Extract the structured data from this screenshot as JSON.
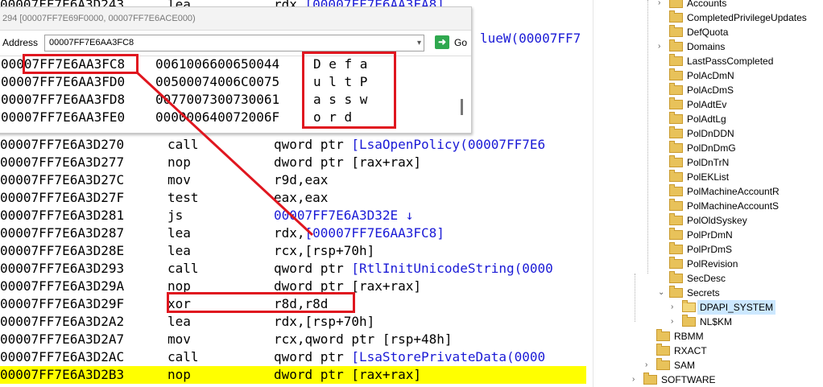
{
  "disasm": {
    "top_partial": {
      "addr": "00007FF7E6A3D243",
      "mnemonic": "lea",
      "operand_plain": "rdx,",
      "operand_link": "[00007FF7E6AA3FA8]"
    },
    "side_fragment": "lueW(00007FF7",
    "rows": [
      {
        "addr": "00007FF7E6A3D270",
        "mnemonic": "call",
        "op": "qword ptr ",
        "link": "[LsaOpenPolicy(00007FF7E6",
        "after": ""
      },
      {
        "addr": "00007FF7E6A3D277",
        "mnemonic": "nop",
        "op": "dword ptr [rax+rax]",
        "link": "",
        "after": ""
      },
      {
        "addr": "00007FF7E6A3D27C",
        "mnemonic": "mov",
        "op": "r9d,eax",
        "link": "",
        "after": ""
      },
      {
        "addr": "00007FF7E6A3D27F",
        "mnemonic": "test",
        "op": "eax,eax",
        "link": "",
        "after": ""
      },
      {
        "addr": "00007FF7E6A3D281",
        "mnemonic": "js",
        "op": "",
        "link": "00007FF7E6A3D32E",
        "after": " ↓"
      },
      {
        "addr": "00007FF7E6A3D287",
        "mnemonic": "lea",
        "op": "rdx,",
        "link": "[00007FF7E6AA3FC8]",
        "after": ""
      },
      {
        "addr": "00007FF7E6A3D28E",
        "mnemonic": "lea",
        "op": "rcx,[rsp+70h]",
        "link": "",
        "after": ""
      },
      {
        "addr": "00007FF7E6A3D293",
        "mnemonic": "call",
        "op": "qword ptr ",
        "link": "[RtlInitUnicodeString(0000",
        "after": ""
      },
      {
        "addr": "00007FF7E6A3D29A",
        "mnemonic": "nop",
        "op": "dword ptr [rax+rax]",
        "link": "",
        "after": ""
      },
      {
        "addr": "00007FF7E6A3D29F",
        "mnemonic": "xor",
        "op": "r8d,r8d",
        "link": "",
        "after": ""
      },
      {
        "addr": "00007FF7E6A3D2A2",
        "mnemonic": "lea",
        "op": "rdx,[rsp+70h]",
        "link": "",
        "after": ""
      },
      {
        "addr": "00007FF7E6A3D2A7",
        "mnemonic": "mov",
        "op": "rcx,qword ptr [rsp+48h]",
        "link": "",
        "after": ""
      },
      {
        "addr": "00007FF7E6A3D2AC",
        "mnemonic": "call",
        "op": "qword ptr ",
        "link": "[LsaStorePrivateData(0000",
        "after": ""
      },
      {
        "addr": "00007FF7E6A3D2B3",
        "mnemonic": "nop",
        "op": "dword ptr [rax+rax]",
        "link": "",
        "after": ""
      }
    ],
    "current_row_index": 13,
    "highlight_color": "#ffff00",
    "link_color": "#1a1ad6"
  },
  "memory_window": {
    "title": "294 [00007FF7E69F0000, 00007FF7E6ACE000)",
    "address_label": "Address",
    "address_value": "00007FF7E6AA3FC8",
    "go_label": "Go",
    "rows": [
      {
        "addr": "00007FF7E6AA3FC8",
        "hex": "0061006600650044",
        "ascii": "D e f a"
      },
      {
        "addr": "00007FF7E6AA3FD0",
        "hex": "00500074006C0075",
        "ascii": "u l t P"
      },
      {
        "addr": "00007FF7E6AA3FD8",
        "hex": "0077007300730061",
        "ascii": "a s s w"
      },
      {
        "addr": "00007FF7E6AA3FE0",
        "hex": "000000640072006F",
        "ascii": "o r d"
      }
    ]
  },
  "annotation_color": "#e0161f",
  "registry_tree": {
    "items": [
      {
        "label": "Accounts",
        "chevron": "›",
        "selected": false
      },
      {
        "label": "CompletedPrivilegeUpdates",
        "chevron": "",
        "selected": false
      },
      {
        "label": "DefQuota",
        "chevron": "",
        "selected": false
      },
      {
        "label": "Domains",
        "chevron": "›",
        "selected": false
      },
      {
        "label": "LastPassCompleted",
        "chevron": "",
        "selected": false
      },
      {
        "label": "PolAcDmN",
        "chevron": "",
        "selected": false
      },
      {
        "label": "PolAcDmS",
        "chevron": "",
        "selected": false
      },
      {
        "label": "PolAdtEv",
        "chevron": "",
        "selected": false
      },
      {
        "label": "PolAdtLg",
        "chevron": "",
        "selected": false
      },
      {
        "label": "PolDnDDN",
        "chevron": "",
        "selected": false
      },
      {
        "label": "PolDnDmG",
        "chevron": "",
        "selected": false
      },
      {
        "label": "PolDnTrN",
        "chevron": "",
        "selected": false
      },
      {
        "label": "PolEKList",
        "chevron": "",
        "selected": false
      },
      {
        "label": "PolMachineAccountR",
        "chevron": "",
        "selected": false
      },
      {
        "label": "PolMachineAccountS",
        "chevron": "",
        "selected": false
      },
      {
        "label": "PolOldSyskey",
        "chevron": "",
        "selected": false
      },
      {
        "label": "PolPrDmN",
        "chevron": "",
        "selected": false
      },
      {
        "label": "PolPrDmS",
        "chevron": "",
        "selected": false
      },
      {
        "label": "PolRevision",
        "chevron": "",
        "selected": false
      },
      {
        "label": "SecDesc",
        "chevron": "",
        "selected": false
      },
      {
        "label": "Secrets",
        "chevron": "⌄",
        "selected": false
      },
      {
        "label": "DPAPI_SYSTEM",
        "chevron": "›",
        "selected": true
      },
      {
        "label": "NL$KM",
        "chevron": "›",
        "selected": false
      },
      {
        "label": "RBMM",
        "chevron": "",
        "selected": false
      },
      {
        "label": "RXACT",
        "chevron": "",
        "selected": false
      },
      {
        "label": "SAM",
        "chevron": "›",
        "selected": false
      },
      {
        "label": "SOFTWARE",
        "chevron": "›",
        "selected": false
      }
    ],
    "folder_color": "#e8c25a"
  }
}
